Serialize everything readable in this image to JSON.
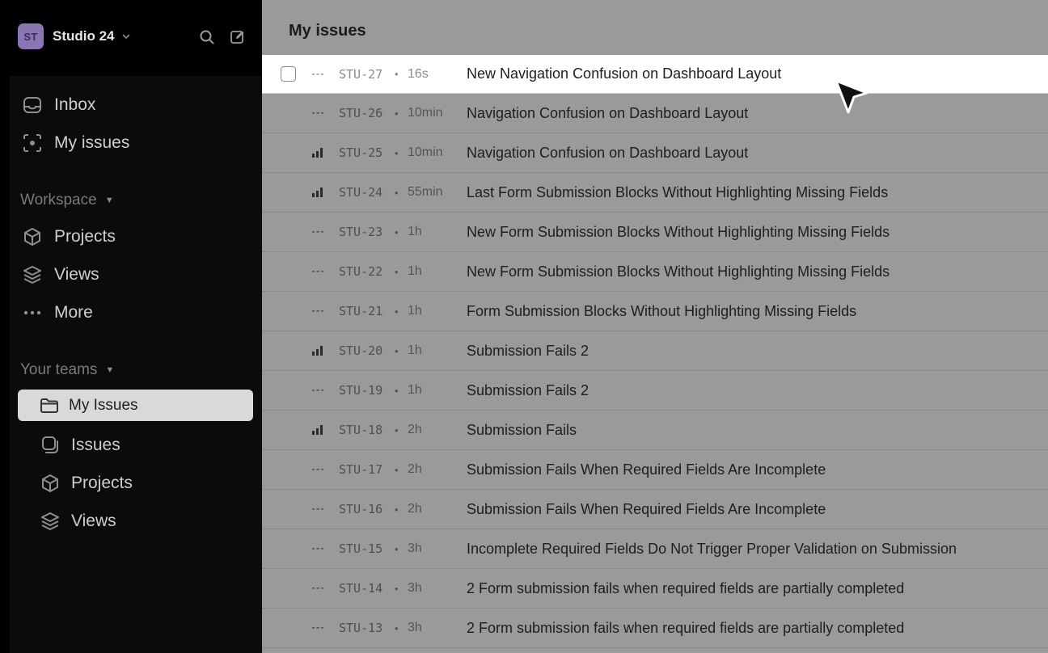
{
  "workspace": {
    "initials": "ST",
    "name": "Studio 24"
  },
  "sidebar": {
    "top_items": [
      {
        "label": "Inbox",
        "icon": "inbox-icon"
      },
      {
        "label": "My issues",
        "icon": "my-issues-icon"
      }
    ],
    "workspace_section": {
      "title": "Workspace",
      "items": [
        {
          "label": "Projects",
          "icon": "cube-icon"
        },
        {
          "label": "Views",
          "icon": "layers-icon"
        },
        {
          "label": "More",
          "icon": "more-dots-icon"
        }
      ]
    },
    "teams_section": {
      "title": "Your teams",
      "team": {
        "label": "My Issues",
        "icon": "folder-icon"
      },
      "items": [
        {
          "label": "Issues",
          "icon": "issues-icon"
        },
        {
          "label": "Projects",
          "icon": "cube-icon"
        },
        {
          "label": "Views",
          "icon": "layers-icon"
        }
      ]
    }
  },
  "main": {
    "title": "My issues",
    "dot": "•",
    "rows": [
      {
        "id": "STU-27",
        "age": "16s",
        "title": "New Navigation Confusion on Dashboard Layout",
        "priority": "none",
        "highlighted": true
      },
      {
        "id": "STU-26",
        "age": "10min",
        "title": "Navigation Confusion on Dashboard Layout",
        "priority": "none"
      },
      {
        "id": "STU-25",
        "age": "10min",
        "title": "Navigation Confusion on Dashboard Layout",
        "priority": "bars"
      },
      {
        "id": "STU-24",
        "age": "55min",
        "title": "Last Form Submission Blocks Without Highlighting Missing Fields",
        "priority": "bars"
      },
      {
        "id": "STU-23",
        "age": "1h",
        "title": "New Form Submission Blocks Without Highlighting Missing Fields",
        "priority": "none"
      },
      {
        "id": "STU-22",
        "age": "1h",
        "title": "New Form Submission Blocks Without Highlighting Missing Fields",
        "priority": "none"
      },
      {
        "id": "STU-21",
        "age": "1h",
        "title": "Form Submission Blocks Without Highlighting Missing Fields",
        "priority": "none"
      },
      {
        "id": "STU-20",
        "age": "1h",
        "title": "Submission Fails 2",
        "priority": "bars"
      },
      {
        "id": "STU-19",
        "age": "1h",
        "title": "Submission Fails 2",
        "priority": "none"
      },
      {
        "id": "STU-18",
        "age": "2h",
        "title": "Submission Fails",
        "priority": "bars"
      },
      {
        "id": "STU-17",
        "age": "2h",
        "title": "Submission Fails When Required Fields Are Incomplete",
        "priority": "none"
      },
      {
        "id": "STU-16",
        "age": "2h",
        "title": "Submission Fails When Required Fields Are Incomplete",
        "priority": "none"
      },
      {
        "id": "STU-15",
        "age": "3h",
        "title": "Incomplete Required Fields Do Not Trigger Proper Validation on Submission",
        "priority": "none"
      },
      {
        "id": "STU-14",
        "age": "3h",
        "title": "2 Form submission fails when required fields are partially completed",
        "priority": "none"
      },
      {
        "id": "STU-13",
        "age": "3h",
        "title": "2 Form submission fails when required fields are partially completed",
        "priority": "none"
      }
    ]
  },
  "colors": {
    "avatar_bg": "#8a76b3",
    "overlay_main": "#9a9a9a",
    "highlight_row": "#ffffff"
  }
}
